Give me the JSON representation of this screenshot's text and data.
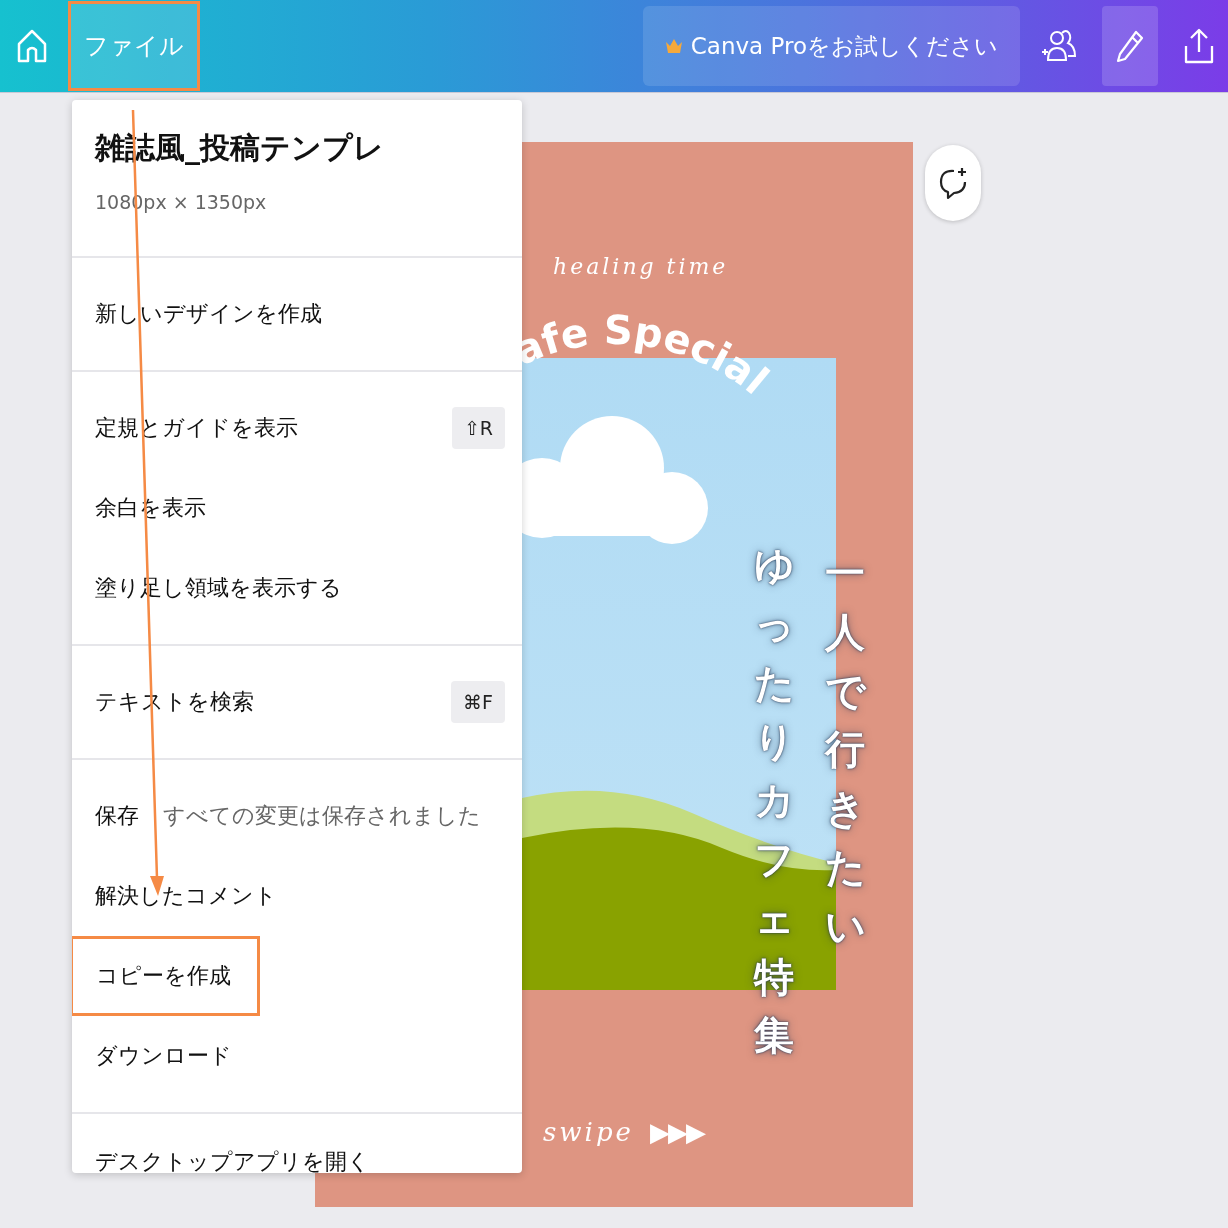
{
  "topbar": {
    "file_button": {
      "label": "ファイル",
      "highlighted": true
    },
    "pro_button": {
      "label": "Canva Proをお試しください"
    },
    "pencil_selected": true
  },
  "menu": {
    "title": "雑誌風_投稿テンプレ",
    "size": "1080px × 1350px",
    "sections": [
      [
        {
          "label": "新しいデザインを作成",
          "highlighted": false
        }
      ],
      [
        {
          "label": "定規とガイドを表示",
          "shortcut": "⇧R",
          "highlighted": false
        },
        {
          "label": "余白を表示",
          "highlighted": false
        },
        {
          "label": "塗り足し領域を表示する",
          "highlighted": false
        }
      ],
      [
        {
          "label": "テキストを検索",
          "shortcut": "⌘F",
          "highlighted": false
        }
      ],
      [
        {
          "label": "保存",
          "status": "すべての変更は保存されました",
          "highlighted": false
        },
        {
          "label": "解決したコメント",
          "highlighted": false
        },
        {
          "label": "コピーを作成",
          "highlighted": true
        },
        {
          "label": "ダウンロード",
          "highlighted": false
        }
      ],
      [
        {
          "label": "デスクトップアプリを開く",
          "highlighted": false
        }
      ]
    ]
  },
  "design": {
    "script_top": "healing time",
    "arc_title": "afe Special",
    "vertical_right": "一人で行きたい",
    "vertical_left": "ゆったりカフェ特集",
    "script_bottom": "swipe",
    "arrows": "▶▶▶"
  }
}
